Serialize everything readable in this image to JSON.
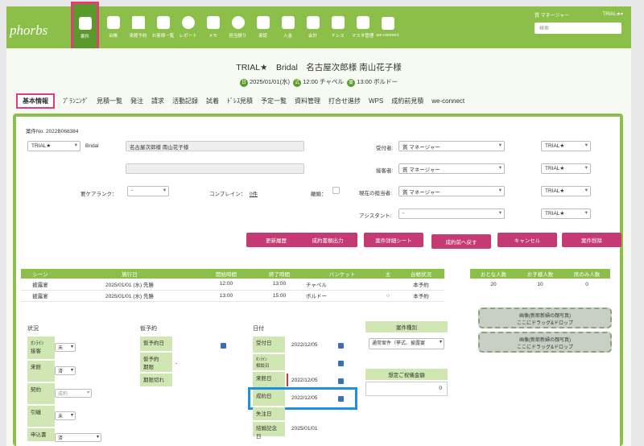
{
  "brand": "phorbs",
  "nav": [
    {
      "label": "案件",
      "icon": "clipboard-icon",
      "active": true
    },
    {
      "label": "台帳",
      "icon": "calendar-icon"
    },
    {
      "label": "来館予約",
      "icon": "chapel-icon"
    },
    {
      "label": "お客様一覧",
      "icon": "contact-card-icon"
    },
    {
      "label": "レポート",
      "icon": "pie-chart-icon"
    },
    {
      "label": "メモ",
      "icon": "pencil-icon"
    },
    {
      "label": "担当振り",
      "icon": "add-person-icon"
    },
    {
      "label": "承認",
      "icon": "stamp-icon"
    },
    {
      "label": "入金",
      "icon": "money-icon"
    },
    {
      "label": "会計",
      "icon": "calculator-icon"
    },
    {
      "label": "ドレス",
      "icon": "dress-icon"
    },
    {
      "label": "マスタ管理",
      "icon": "gear-icon"
    },
    {
      "label": "we-connect",
      "icon": "people-gear-icon"
    }
  ],
  "user": {
    "name": "質 マネージャー",
    "tenant": "TRIAL★▾",
    "search_placeholder": "検索"
  },
  "header": {
    "title": "TRIAL★　Bridal　名古屋次郎様 南山花子様",
    "date_badge": "日",
    "date": "2025/01/01(水)",
    "ceremony_badge": "式",
    "ceremony": "12:00 チャペル",
    "reception_badge": "宴",
    "reception": "13:00 ボルドー"
  },
  "tabs": [
    "基本情報",
    "ﾌﾟﾗﾝﾆﾝｸﾞ",
    "見積一覧",
    "発注",
    "請求",
    "活動記録",
    "試着",
    "ﾄﾞﾚｽ見積",
    "予定一覧",
    "資料管理",
    "打合せ進捗",
    "WPS",
    "成約前見積",
    "we-connect"
  ],
  "form": {
    "case_no": "案件No. 2022B068384",
    "venue": "TRIAL★",
    "type": "Bridal",
    "couple": "名古屋次郎様 南山花子様",
    "care_label": "要ケアランク：",
    "care_value": "-",
    "complain_label": "コンプレイン：",
    "complain_value": "0件",
    "separated_label": "離婚：",
    "receiver_label": "受付者:",
    "receiver": "質 マネージャー",
    "contact_label": "接客者:",
    "contact": "質 マネージャー",
    "current_label": "現在の担当者:",
    "current": "質 マネージャー",
    "assistant_label": "アシスタント:",
    "assistant": "-",
    "tenant_sel": "TRIAL★"
  },
  "buttons": [
    "更新履歴",
    "成約書類出力",
    "案件詳細シート",
    "成約前へ戻す",
    "キャンセル",
    "案件削除"
  ],
  "schedule": {
    "headers": [
      "シーン",
      "施行日",
      "開始時間",
      "終了時間",
      "バンケット",
      "主",
      "台帳状況"
    ],
    "rows": [
      [
        "披露宴",
        "2025/01/01 (水) 先勝",
        "12:00",
        "13:00",
        "チャペル",
        "",
        "本予約"
      ],
      [
        "披露宴",
        "2025/01/01 (水) 先勝",
        "13:00",
        "15:00",
        "ボルドー",
        "○",
        "本予約"
      ]
    ]
  },
  "counts": {
    "headers": [
      "おとな人数",
      "お子様人数",
      "席のみ人数"
    ],
    "values": [
      "20",
      "10",
      "0"
    ]
  },
  "drops": [
    "画像(新郎新婦の顔写真)\nここにドラッグ&ドロップ",
    "画像(新郎新婦の顔写真)\nここにドラッグ&ドロップ"
  ],
  "status": {
    "title": "状況",
    "rows": [
      {
        "label": "ｵﾝﾗｲﾝ\n接客",
        "value": "未"
      },
      {
        "label": "来館",
        "value": "済"
      },
      {
        "label": "契約",
        "value": "成約"
      },
      {
        "label": "引継",
        "value": "未"
      },
      {
        "label": "申込書",
        "value": "済"
      }
    ]
  },
  "provisional": {
    "title": "仮予約",
    "rows": [
      {
        "label": "仮予約日",
        "value": ""
      },
      {
        "label": "仮予約\n期限",
        "value": "-"
      },
      {
        "label": "期限切れ",
        "value": ""
      }
    ]
  },
  "dates": {
    "title": "日付",
    "rows": [
      {
        "label": "受付日",
        "value": "2022/12/05"
      },
      {
        "label": "ｵﾝﾗｲﾝ\n相談日",
        "value": ""
      },
      {
        "label": "来館日",
        "value": "2022/12/05"
      },
      {
        "label": "成約日",
        "value": "2022/12/05"
      },
      {
        "label": "失注日",
        "value": ""
      },
      {
        "label": "結婚記念日",
        "value": "2025/01/01"
      }
    ]
  },
  "case_type": {
    "title": "案件種別",
    "value": "通常案件（挙式、披露宴"
  },
  "estimate": {
    "title": "想定ご祝儀金額",
    "value": "0"
  }
}
